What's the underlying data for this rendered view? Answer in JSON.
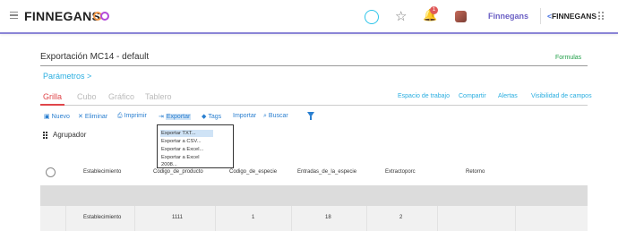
{
  "topbar": {
    "logo_text": "FINNEGANS",
    "logo_mark": "CO",
    "notification_count": "1",
    "company_name": "Finnegans",
    "brand_right": "FINNEGANS",
    "icons": [
      "hamburger-icon",
      "search-icon",
      "star-icon",
      "bell-icon",
      "avatar",
      "apps-grid-icon"
    ],
    "accent_color": "#8a84d6"
  },
  "page": {
    "title": "Exportación MC14 - default",
    "formulas_link": "Formulas",
    "params_link": "Parámetros >"
  },
  "tabs": [
    "Grilla",
    "Cubo",
    "Gráfico",
    "Tablero"
  ],
  "right_links": [
    "Espacio de trabajo",
    "Compartir",
    "Alertas",
    "Visibilidad de campos"
  ],
  "toolbar": {
    "nuevo": "Nuevo",
    "eliminar": "Eliminar",
    "imprimir": "Imprimir",
    "exportar": "Exportar",
    "tags": "Tags",
    "importar": "Importar",
    "buscar": "Buscar"
  },
  "agrupador": "Agrupador",
  "export_menu": [
    "Exportar TXT...",
    "Exportar a CSV...",
    "Exportar a Excel...",
    "Exportar a Excel 2008..."
  ],
  "table": {
    "headers": [
      "Establecimiento",
      "Codigo_de_producto",
      "Codigo_de_especie",
      "Entradas_de_la_especie",
      "Extractoporc",
      "Retorno"
    ],
    "rows": [
      [
        "Establecimiento",
        "1111",
        "1",
        "18",
        "2",
        ""
      ]
    ]
  }
}
